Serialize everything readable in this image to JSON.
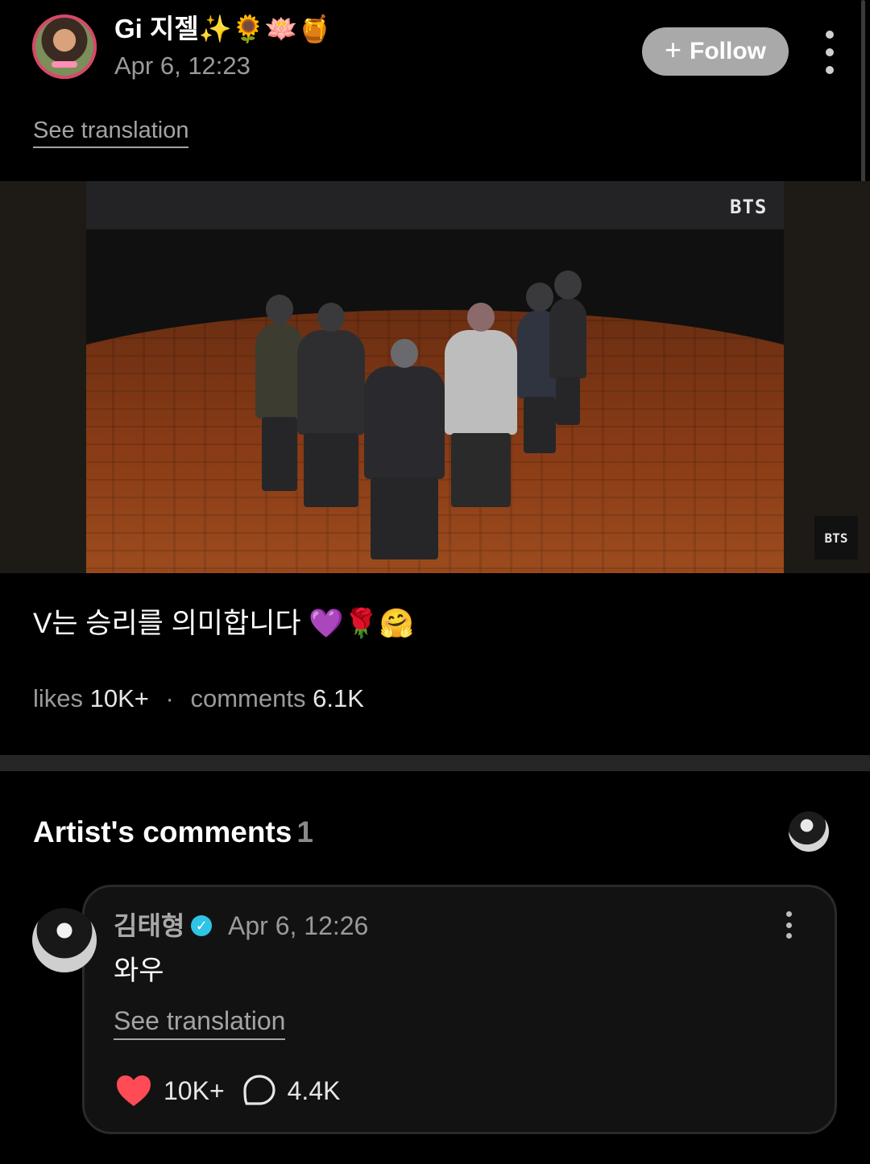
{
  "post": {
    "author_name": "Gi 지젤✨🌻🪷🍯",
    "timestamp": "Apr 6, 12:23",
    "follow_label": "Follow",
    "see_translation_label": "See translation",
    "media": {
      "watermark": "BTS",
      "badge_label": "BTS"
    },
    "caption": "V는 승리를 의미합니다 💜🌹🤗",
    "stats": {
      "likes_label": "likes",
      "likes_value": "10K+",
      "separator": "·",
      "comments_label": "comments",
      "comments_value": "6.1K"
    }
  },
  "artist_comments": {
    "title": "Artist's comments",
    "count": "1",
    "comments": [
      {
        "author_name": "김태형",
        "verified": true,
        "timestamp": "Apr 6, 12:26",
        "text": "와우",
        "see_translation_label": "See translation",
        "likes": "10K+",
        "replies": "4.4K"
      }
    ]
  },
  "colors": {
    "background": "#000000",
    "follow_button": "#a9a9a9",
    "like_heart": "#ff4b55",
    "verified_badge": "#2ec4e6",
    "muted_text": "#9a9a9a"
  },
  "icons": [
    "more-vertical-icon",
    "plus-icon",
    "verified-icon",
    "heart-icon",
    "comment-bubble-icon"
  ]
}
